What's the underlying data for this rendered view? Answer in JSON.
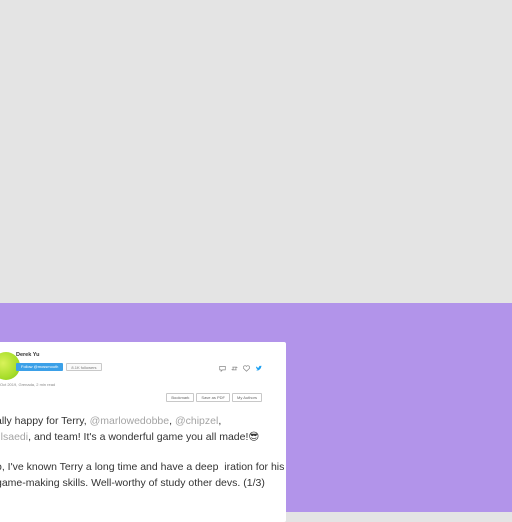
{
  "tweet": {
    "author_name": "Derek Yu",
    "follow_label": "Follow @mossmouth",
    "followers_label": "8.1K followers",
    "meta": "Oct 2019, Grenada, 2 min read",
    "buttons": [
      "Bookmark",
      "Save as PDF",
      "My Authors"
    ],
    "line1_text": "ally happy for Terry, ",
    "mention1": "@marlowedobbe",
    "sep1": ", ",
    "mention2": "@chipzel",
    "sep2": ",",
    "mention3": "illsaedi",
    "line1_end": ", and team! It's a wonderful game you all made!",
    "line1_emoji": "😎",
    "para2": "o, I've known Terry a long time and have a deep  iration for his game-making skills. Well-worthy of study other devs. (1/3)"
  },
  "colors": {
    "purple_background": "#b294ea",
    "top_background": "#e4e4e4",
    "follow_blue": "#3ba0e8",
    "twitter_blue": "#1da1f2"
  },
  "icons": [
    "reply-icon",
    "retweet-icon",
    "like-icon",
    "twitter-bird-icon"
  ]
}
